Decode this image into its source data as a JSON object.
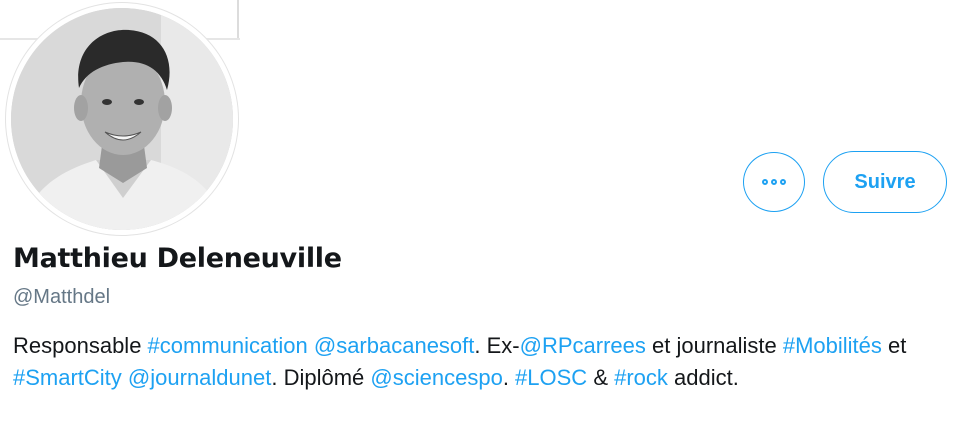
{
  "profile": {
    "name": "Matthieu Deleneuville",
    "handle": "@Matthdel",
    "follow_label": "Suivre",
    "more_icon": "more-options-icon",
    "bio": [
      {
        "text": "Responsable ",
        "link": false
      },
      {
        "text": "#communication",
        "link": true
      },
      {
        "text": " ",
        "link": false
      },
      {
        "text": "@sarbacanesoft",
        "link": true
      },
      {
        "text": ". Ex-",
        "link": false
      },
      {
        "text": "@RPcarrees",
        "link": true
      },
      {
        "text": " et journaliste ",
        "link": false
      },
      {
        "text": "#Mobilités",
        "link": true
      },
      {
        "text": " et ",
        "link": false
      },
      {
        "text": "#SmartCity",
        "link": true
      },
      {
        "text": " ",
        "link": false
      },
      {
        "text": "@journaldunet",
        "link": true
      },
      {
        "text": ". Diplômé ",
        "link": false
      },
      {
        "text": "@sciencespo",
        "link": true
      },
      {
        "text": ". ",
        "link": false
      },
      {
        "text": "#LOSC",
        "link": true
      },
      {
        "text": " & ",
        "link": false
      },
      {
        "text": "#rock",
        "link": true
      },
      {
        "text": " addict.",
        "link": false
      }
    ]
  },
  "colors": {
    "accent": "#1da1f2",
    "text": "#14171a",
    "secondary_text": "#657786"
  }
}
